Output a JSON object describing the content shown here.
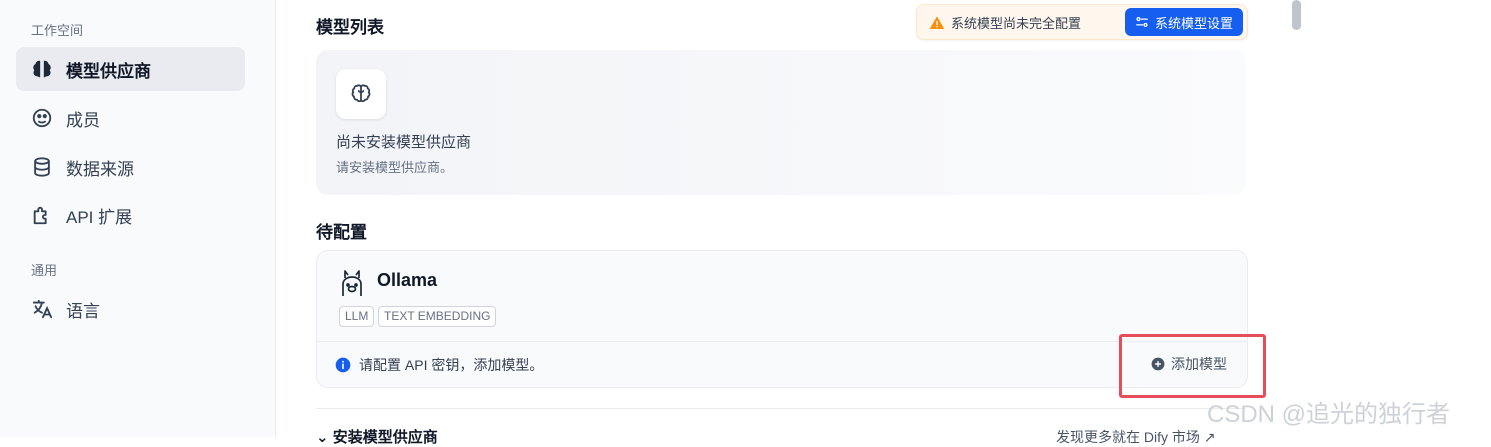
{
  "sidebar": {
    "workspace_label": "工作空间",
    "items": [
      {
        "label": "模型供应商",
        "icon": "brain-icon"
      },
      {
        "label": "成员",
        "icon": "members-icon"
      },
      {
        "label": "数据来源",
        "icon": "database-icon"
      },
      {
        "label": "API 扩展",
        "icon": "puzzle-icon"
      }
    ],
    "general_label": "通用",
    "general_items": [
      {
        "label": "语言",
        "icon": "translate-icon"
      }
    ]
  },
  "main": {
    "model_list_title": "模型列表",
    "warning_text": "系统模型尚未完全配置",
    "system_settings_button": "系统模型设置",
    "empty_title": "尚未安装模型供应商",
    "empty_sub": "请安装模型供应商。",
    "to_configure_title": "待配置",
    "provider": {
      "name": "Ollama",
      "tags": [
        "LLM",
        "TEXT EMBEDDING"
      ],
      "info": "请配置 API 密钥，添加模型。",
      "add_model": "添加模型"
    },
    "install_section_title": "安装模型供应商",
    "discover_more": "发现更多就在 Dify 市场"
  },
  "watermark": "CSDN @追光的独行者",
  "colors": {
    "accent": "#155eef",
    "warning": "#f79009",
    "highlight": "#e74c5b"
  }
}
